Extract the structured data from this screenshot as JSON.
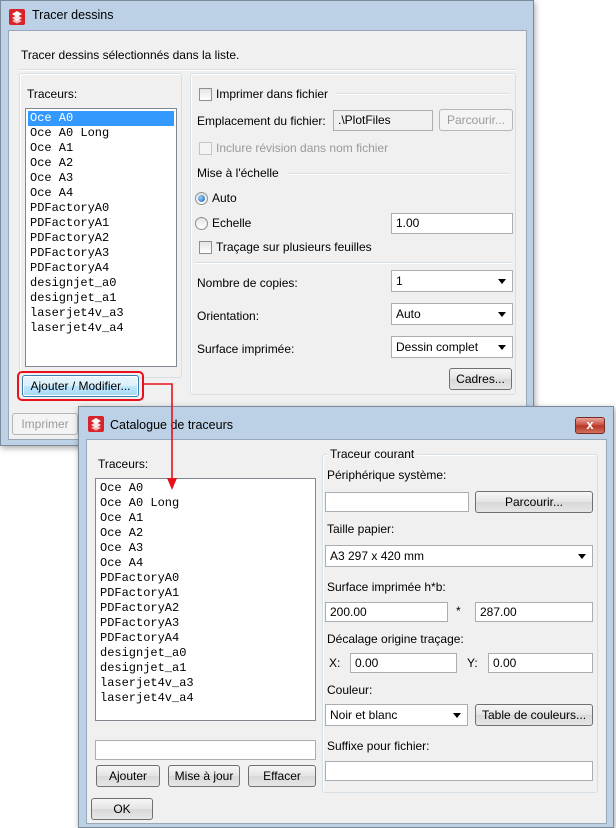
{
  "dialog": {
    "title": "Tracer dessins",
    "instruction": "Tracer dessins sélectionnés dans la liste.",
    "plotters_label": "Traceurs:",
    "plotters": [
      "Oce A0",
      "Oce A0 Long",
      "Oce A1",
      "Oce A2",
      "Oce A3",
      "Oce A4",
      "PDFactoryA0",
      "PDFactoryA1",
      "PDFactoryA2",
      "PDFactoryA3",
      "PDFactoryA4",
      "designjet_a0",
      "designjet_a1",
      "laserjet4v_a3",
      "laserjet4v_a4"
    ],
    "selected_plotter": "Oce A0",
    "add_modify_label": "Ajouter / Modifier...",
    "print_to_file_label": "Imprimer dans fichier",
    "file_location_label": "Emplacement du fichier:",
    "file_location_value": ".\\PlotFiles",
    "browse_label": "Parcourir...",
    "include_revision_label": "Inclure révision dans nom fichier",
    "scale_section_label": "Mise à l'échelle",
    "auto_label": "Auto",
    "scale_label": "Echelle",
    "scale_value": "1.00",
    "multi_sheet_label": "Traçage sur plusieurs feuilles",
    "copies_label": "Nombre de copies:",
    "copies_value": "1",
    "orientation_label": "Orientation:",
    "orientation_value": "Auto",
    "print_area_label": "Surface imprimée:",
    "print_area_value": "Dessin complet",
    "frames_label": "Cadres...",
    "print_button_label": "Imprimer"
  },
  "catalog": {
    "title": "Catalogue de traceurs",
    "plotters_label": "Traceurs:",
    "plotters": [
      "Oce A0",
      "Oce A0 Long",
      "Oce A1",
      "Oce A2",
      "Oce A3",
      "Oce A4",
      "PDFactoryA0",
      "PDFactoryA1",
      "PDFactoryA2",
      "PDFactoryA3",
      "PDFactoryA4",
      "designjet_a0",
      "designjet_a1",
      "laserjet4v_a3",
      "laserjet4v_a4"
    ],
    "name_value": "",
    "add_label": "Ajouter",
    "update_label": "Mise à jour",
    "delete_label": "Effacer",
    "current_plotter_label": "Traceur courant",
    "system_device_label": "Périphérique système:",
    "system_device_value": "",
    "browse_label": "Parcourir...",
    "paper_size_label": "Taille papier:",
    "paper_size_value": "A3 297 x 420 mm",
    "print_area_label": "Surface imprimée h*b:",
    "print_area_h": "200.00",
    "times_sign": "*",
    "print_area_b": "287.00",
    "offset_label": "Décalage origine traçage:",
    "x_label": "X:",
    "x_value": "0.00",
    "y_label": "Y:",
    "y_value": "0.00",
    "color_label": "Couleur:",
    "color_value": "Noir et blanc",
    "color_table_label": "Table de couleurs...",
    "file_suffix_label": "Suffixe pour fichier:",
    "file_suffix_value": "",
    "ok_label": "OK",
    "close_glyph": "x"
  },
  "colors": {
    "highlight_red": "#e8101a",
    "selection_blue": "#3399ff"
  }
}
